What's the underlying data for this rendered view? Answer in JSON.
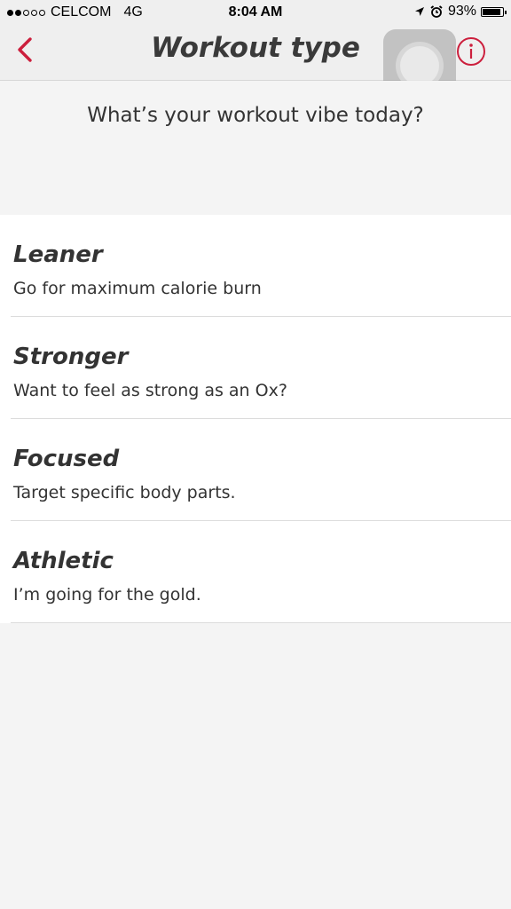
{
  "status_bar": {
    "carrier": "CELCOM",
    "network": "4G",
    "time": "8:04 AM",
    "battery_text": "93%",
    "battery_level": 0.93
  },
  "nav": {
    "title": "Workout type",
    "back_icon": "chevron-left-icon",
    "info_icon": "info-icon"
  },
  "prompt": "What’s your workout vibe today?",
  "options": [
    {
      "title": "Leaner",
      "description": "Go for maximum calorie burn"
    },
    {
      "title": "Stronger",
      "description": "Want to feel as strong as an Ox?"
    },
    {
      "title": "Focused",
      "description": "Target specific body parts."
    },
    {
      "title": "Athletic",
      "description": "I’m going for the gold."
    }
  ],
  "colors": {
    "accent": "#cc1f3d",
    "title_text": "#3a3a3a",
    "background": "#f4f4f4",
    "list_background": "#ffffff"
  }
}
